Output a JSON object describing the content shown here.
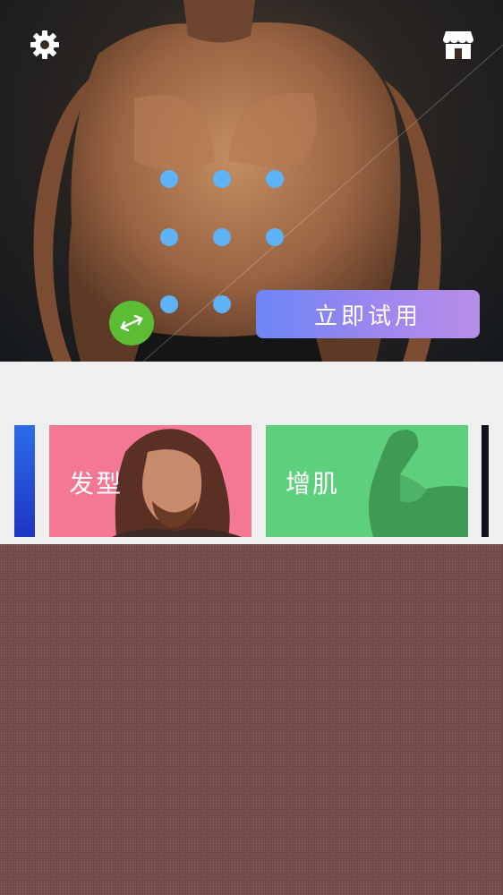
{
  "header": {
    "settings_icon": "gear-icon",
    "store_icon": "store-icon"
  },
  "pattern_lock": {
    "dot_color": "#5fb2f5",
    "dot_count": 8
  },
  "actions": {
    "swap_icon": "swap-arrows-icon",
    "try_now_label": "立即试用"
  },
  "categories": [
    {
      "label": "发型",
      "color": "#f47793"
    },
    {
      "label": "增肌",
      "color": "#5ecf7c"
    }
  ],
  "colors": {
    "swap_button": "#5cbd34",
    "try_gradient_start": "#6b87f5",
    "try_gradient_end": "#b78ee8",
    "overlay": "#714b48"
  }
}
